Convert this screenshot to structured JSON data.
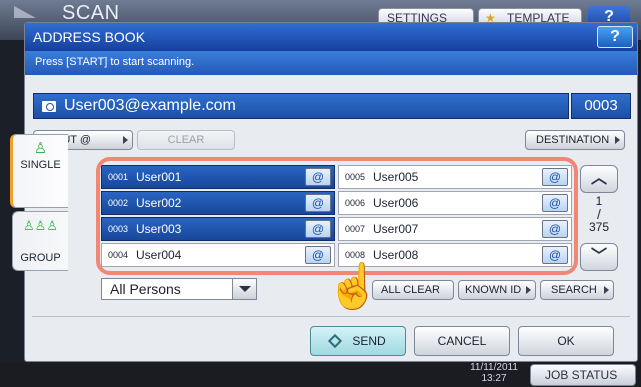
{
  "background": {
    "app_title": "SCAN",
    "settings_label": "SETTINGS",
    "template_label": "TEMPLATE",
    "help_label": "?",
    "date_line": "11/11/2011",
    "time_line": "13:27",
    "job_status_label": "JOB STATUS"
  },
  "dialog": {
    "title": "ADDRESS BOOK",
    "help_label": "?",
    "message": "Press [START] to start scanning."
  },
  "destination": {
    "address": "User003@example.com",
    "count": "0003"
  },
  "toolbar": {
    "input_label": "INPUT @",
    "clear_label": "CLEAR",
    "destination_label": "DESTINATION"
  },
  "tabs": {
    "single_label": "SINGLE",
    "group_label": "GROUP"
  },
  "entries": [
    {
      "num": "0001",
      "name": "User001",
      "selected": true
    },
    {
      "num": "0002",
      "name": "User002",
      "selected": true
    },
    {
      "num": "0003",
      "name": "User003",
      "selected": true
    },
    {
      "num": "0004",
      "name": "User004",
      "selected": false
    },
    {
      "num": "0005",
      "name": "User005",
      "selected": false
    },
    {
      "num": "0006",
      "name": "User006",
      "selected": false
    },
    {
      "num": "0007",
      "name": "User007",
      "selected": false
    },
    {
      "num": "0008",
      "name": "User008",
      "selected": false
    }
  ],
  "at_symbol": "@",
  "pager": {
    "current": "1",
    "total": "375"
  },
  "filter": {
    "selected": "All Persons"
  },
  "actions": {
    "all_clear_label": "ALL CLEAR",
    "known_id_label": "KNOWN ID",
    "search_label": "SEARCH"
  },
  "footer": {
    "send_label": "SEND",
    "cancel_label": "CANCEL",
    "ok_label": "OK"
  },
  "colors": {
    "accent_blue": "#1f55b0",
    "highlight": "#f08875",
    "tab_marker": "#f0a02a"
  }
}
